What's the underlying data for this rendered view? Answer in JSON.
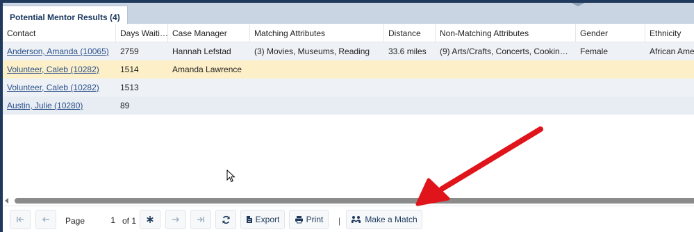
{
  "tab": {
    "label": "Potential Mentor Results (4)"
  },
  "columns": [
    "Contact",
    "Days Waiti…",
    "Case Manager",
    "Matching Attributes",
    "Distance",
    "Non-Matching Attributes",
    "Gender",
    "Ethnicity"
  ],
  "rows": [
    {
      "contact": "Anderson, Amanda (10065)",
      "days": "2759",
      "case_manager": "Hannah Lefstad",
      "matching": "(3) Movies, Museums, Reading",
      "distance": "33.6 miles",
      "non_matching": "(9) Arts/Crafts, Concerts, Cooking…",
      "gender": "Female",
      "ethnicity": "African Ame"
    },
    {
      "contact": "Volunteer, Caleb (10282)",
      "days": "1514",
      "case_manager": "Amanda Lawrence",
      "matching": "",
      "distance": "",
      "non_matching": "",
      "gender": "",
      "ethnicity": ""
    },
    {
      "contact": "Volunteer, Caleb (10282)",
      "days": "1513",
      "case_manager": "",
      "matching": "",
      "distance": "",
      "non_matching": "",
      "gender": "",
      "ethnicity": ""
    },
    {
      "contact": "Austin, Julie (10280)",
      "days": "89",
      "case_manager": "",
      "matching": "",
      "distance": "",
      "non_matching": "",
      "gender": "",
      "ethnicity": ""
    }
  ],
  "pager": {
    "page_label": "Page",
    "page_value": "1",
    "of_label": "of 1",
    "export_label": "Export",
    "print_label": "Print",
    "separator": "|",
    "match_label": "Make a Match"
  },
  "colors": {
    "frame": "#1f3a5c",
    "tab_bar": "#c9d5e3",
    "link": "#2a4f8a",
    "selected_row": "#fdf0c8",
    "arrow_annotation": "#e0141b"
  },
  "icons": [
    "first-page-icon",
    "prev-page-icon",
    "asterisk-icon",
    "next-page-icon",
    "last-page-icon",
    "refresh-icon",
    "export-file-icon",
    "printer-icon",
    "people-match-icon",
    "mouse-cursor-icon"
  ]
}
